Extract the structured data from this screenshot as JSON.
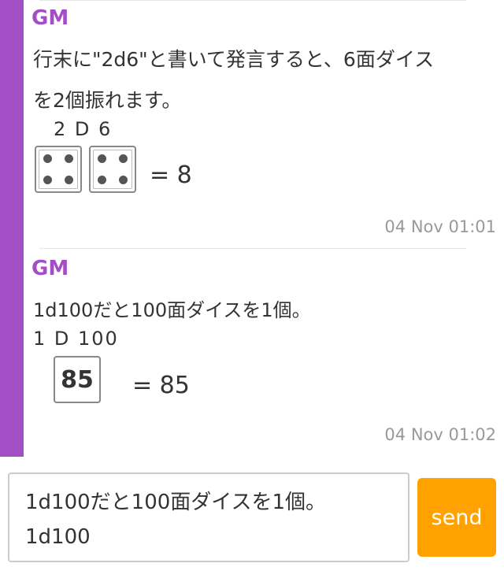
{
  "colors": {
    "accent": "#a24fc6",
    "sender": "#a24fc6",
    "send_button": "#ffa200"
  },
  "messages": [
    {
      "sender": "GM",
      "lines": [
        "行末に\"2d6\"と書いて発言すると、6面ダイス",
        "を2個振れます。"
      ],
      "notation": "2 D 6",
      "dice": [
        4,
        4
      ],
      "result": "= 8",
      "timestamp": "04 Nov 01:01"
    },
    {
      "sender": "GM",
      "lines": [
        "1d100だと100面ダイスを1個。"
      ],
      "notation": "1 D 100",
      "dice_value": "85",
      "result": "= 85",
      "timestamp": "04 Nov 01:02"
    }
  ],
  "composer": {
    "input_value": "1d100だと100面ダイスを1個。\n1d100",
    "send_label": "send"
  }
}
